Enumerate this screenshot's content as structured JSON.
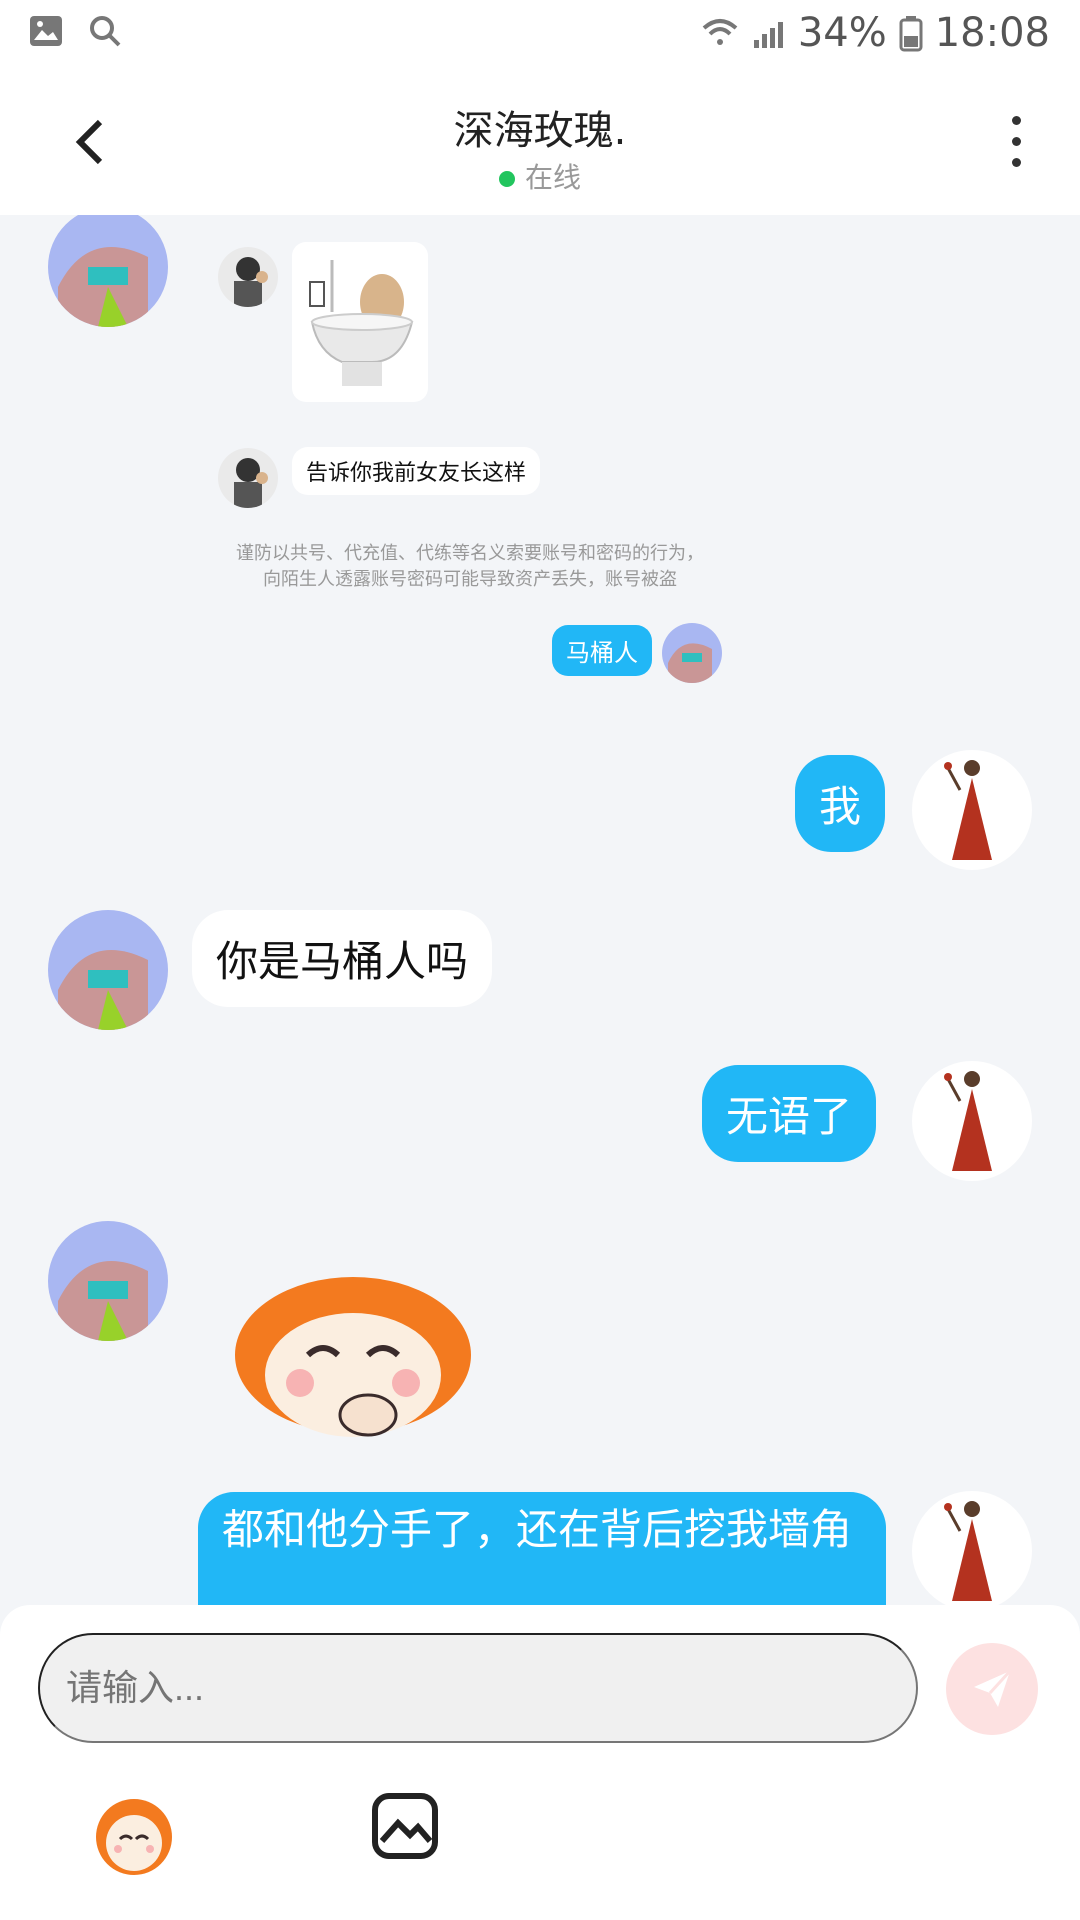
{
  "status_bar": {
    "battery": "34%",
    "time": "18:08"
  },
  "header": {
    "title": "深海玫瑰.",
    "status": "在线"
  },
  "messages": {
    "m1_text": "告诉你我前女友长这样",
    "notice": "谨防以共号、代充值、代练等名义索要账号和密码的行为，向陌生人透露账号密码可能导致资产丢失，账号被盗",
    "m_tag": "马桶人",
    "m_me1": "我",
    "m_other2": "你是马桶人吗",
    "m_me2": "无语了",
    "m_me3": "都和他分手了，还在背后挖我墙角"
  },
  "composer": {
    "placeholder": "请输入..."
  },
  "colors": {
    "accent": "#21b7f6",
    "background": "#f3f5f8",
    "online": "#22c55e"
  },
  "icons": [
    "gallery-icon",
    "search-icon",
    "wifi-icon",
    "signal-icon",
    "battery-icon",
    "back-icon",
    "more-icon",
    "send-icon",
    "emoji-icon",
    "image-icon"
  ]
}
